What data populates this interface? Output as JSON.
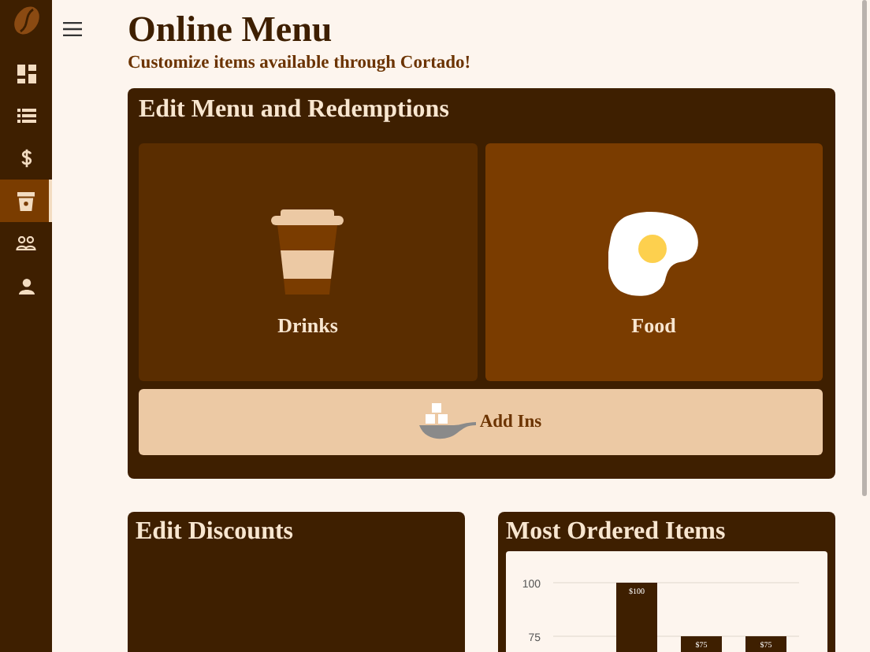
{
  "sidebar": {
    "items": [
      {
        "kind": "dashboard",
        "selected": false
      },
      {
        "kind": "list",
        "selected": false
      },
      {
        "kind": "dollar",
        "selected": false
      },
      {
        "kind": "store",
        "selected": true
      },
      {
        "kind": "people",
        "selected": false
      },
      {
        "kind": "person",
        "selected": false
      }
    ]
  },
  "header": {
    "title": "Online Menu",
    "subtitle": "Customize items available through Cortado!"
  },
  "menu_panel": {
    "title": "Edit Menu and Redemptions",
    "tiles": [
      {
        "kind": "drinks",
        "label": "Drinks",
        "selected": false
      },
      {
        "kind": "food",
        "label": "Food",
        "selected": true
      }
    ],
    "add_ins": {
      "label": "Add Ins"
    }
  },
  "discounts_panel": {
    "title": "Edit Discounts"
  },
  "most_ordered_panel": {
    "title": "Most Ordered Items",
    "chart_data": {
      "type": "bar",
      "values": [
        100,
        75,
        75
      ],
      "yticks": [
        75,
        100
      ],
      "ylim": [
        0,
        100
      ],
      "value_labels": [
        "$100",
        "$75",
        "$75"
      ]
    }
  }
}
